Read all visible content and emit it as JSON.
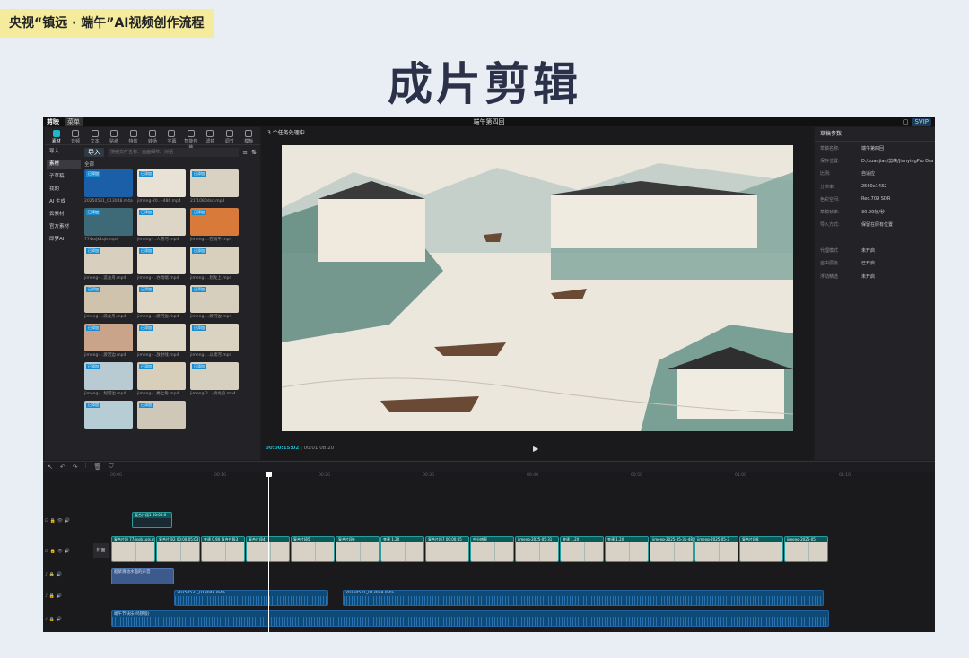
{
  "slide": {
    "tag": "央视“镇远 · 端午”AI视频创作流程",
    "title": "成片剪辑"
  },
  "app": {
    "logo": "剪映",
    "menu": "菜单",
    "project_title": "端午第四回",
    "svip": "SVIP"
  },
  "left_tools": [
    "素材",
    "音频",
    "文本",
    "贴纸",
    "特效",
    "转场",
    "字幕",
    "智能包装",
    "滤镜",
    "调节",
    "模板"
  ],
  "left_side": [
    "导入",
    "素材",
    "子草稿",
    "我的",
    "AI 生成",
    "云素材",
    "官方素材",
    "即梦AI"
  ],
  "media": {
    "import_label": "导入",
    "search_placeholder": "搜索文件名称、画面细节、对话",
    "all_label": "全部",
    "added_badge": "已添加",
    "items": [
      {
        "name": "20250531_013048.m4a",
        "tone": "#1a5fa8"
      },
      {
        "name": "jimeng-20...-486.mp4",
        "tone": "#e8e2d6"
      },
      {
        "name": "21f1080dsd.mp4",
        "tone": "#d9d2c2"
      },
      {
        "name": "774ssjk1qis.mp4",
        "tone": "#3e6a78"
      },
      {
        "name": "jimeng-...人游河.mp4",
        "tone": "#ddd6c6"
      },
      {
        "name": "jimeng-...在端午.mp4",
        "tone": "#d87a3a"
      },
      {
        "name": "jimeng-...造龙舟.mp4",
        "tone": "#d9cfbe"
      },
      {
        "name": "jimeng-...亦戏端.mp4",
        "tone": "#e2dacb"
      },
      {
        "name": "jimeng-...划龙上.mp4",
        "tone": "#d8d0bd"
      },
      {
        "name": "jimeng-...浪龙舟.mp4",
        "tone": "#cfc3ad"
      },
      {
        "name": "jimeng-...渡河边.mp4",
        "tone": "#e0d8c6"
      },
      {
        "name": "jimeng-...渡河边.mp4",
        "tone": "#d6cfbe"
      },
      {
        "name": "jimeng-...渡河边.mp4",
        "tone": "#c9a48a"
      },
      {
        "name": "jimeng-...放射线.mp4",
        "tone": "#ddd5c3"
      },
      {
        "name": "jimeng-...以渡河.mp4",
        "tone": "#dad3c1"
      },
      {
        "name": "jimeng-...划河边.mp4",
        "tone": "#b9cbd2"
      },
      {
        "name": "jimeng-...秀上角.mp4",
        "tone": "#d7cfba"
      },
      {
        "name": "jimeng-2...-桥龙舟.mp4",
        "tone": "#d6d0c0"
      },
      {
        "name": "",
        "tone": "#b7cdd6"
      },
      {
        "name": "",
        "tone": "#cfc8b8"
      }
    ]
  },
  "preview": {
    "header": "3 个任务处理中...",
    "current_time": "00:00:15:02",
    "total_time": "00:01:08:20"
  },
  "draft": {
    "title": "草稿参数",
    "rows": [
      {
        "k": "草稿名称:",
        "v": "端午第四回"
      },
      {
        "k": "保存位置:",
        "v": "D:/xuanjian/剪映/JianyingPro Dra"
      },
      {
        "k": "比例:",
        "v": "自适应"
      },
      {
        "k": "分辨率:",
        "v": "2560x1432"
      },
      {
        "k": "色彩空间:",
        "v": "Rec.709 SDR"
      },
      {
        "k": "草稿帧率:",
        "v": "30.00帧/秒"
      },
      {
        "k": "导入方式:",
        "v": "保留在原有位置"
      },
      {
        "k": "",
        "v": ""
      },
      {
        "k": "代理模式",
        "v": "未开启"
      },
      {
        "k": "自由层级",
        "v": "已开启"
      },
      {
        "k": "浮动精选",
        "v": "未开启"
      }
    ]
  },
  "timeline": {
    "ruler": [
      "00:00",
      "00:10",
      "00:20",
      "00:30",
      "00:40",
      "00:50",
      "01:00",
      "01:10"
    ],
    "cover_label": "封面",
    "overlay_clip": "复合片段1 00:00:0",
    "main_clips": [
      "复合片段 774ssjk1qis.mp4",
      "复合片段2 00:00:05:03",
      "变速 0.9X 复合片段3",
      "复合片段4",
      "复合片段5",
      "复合片段6",
      "变速 1.2X",
      "复合片段7 00:00:05",
      "中分辨率",
      "jimeng-2025-05-31",
      "变速 1.2X",
      "变速 1.2X",
      "jimeng-2025-05-31-486",
      "jimeng-2025-05-3",
      "复合片段8",
      "jimeng-2025-05"
    ],
    "sfx_clip": "船桨滑动水面的声音",
    "audio_a": "20250531_013048.m4a",
    "audio_b": "20250531_013048.m4a",
    "music_clip": "端午节快乐(鸣锣版)"
  }
}
